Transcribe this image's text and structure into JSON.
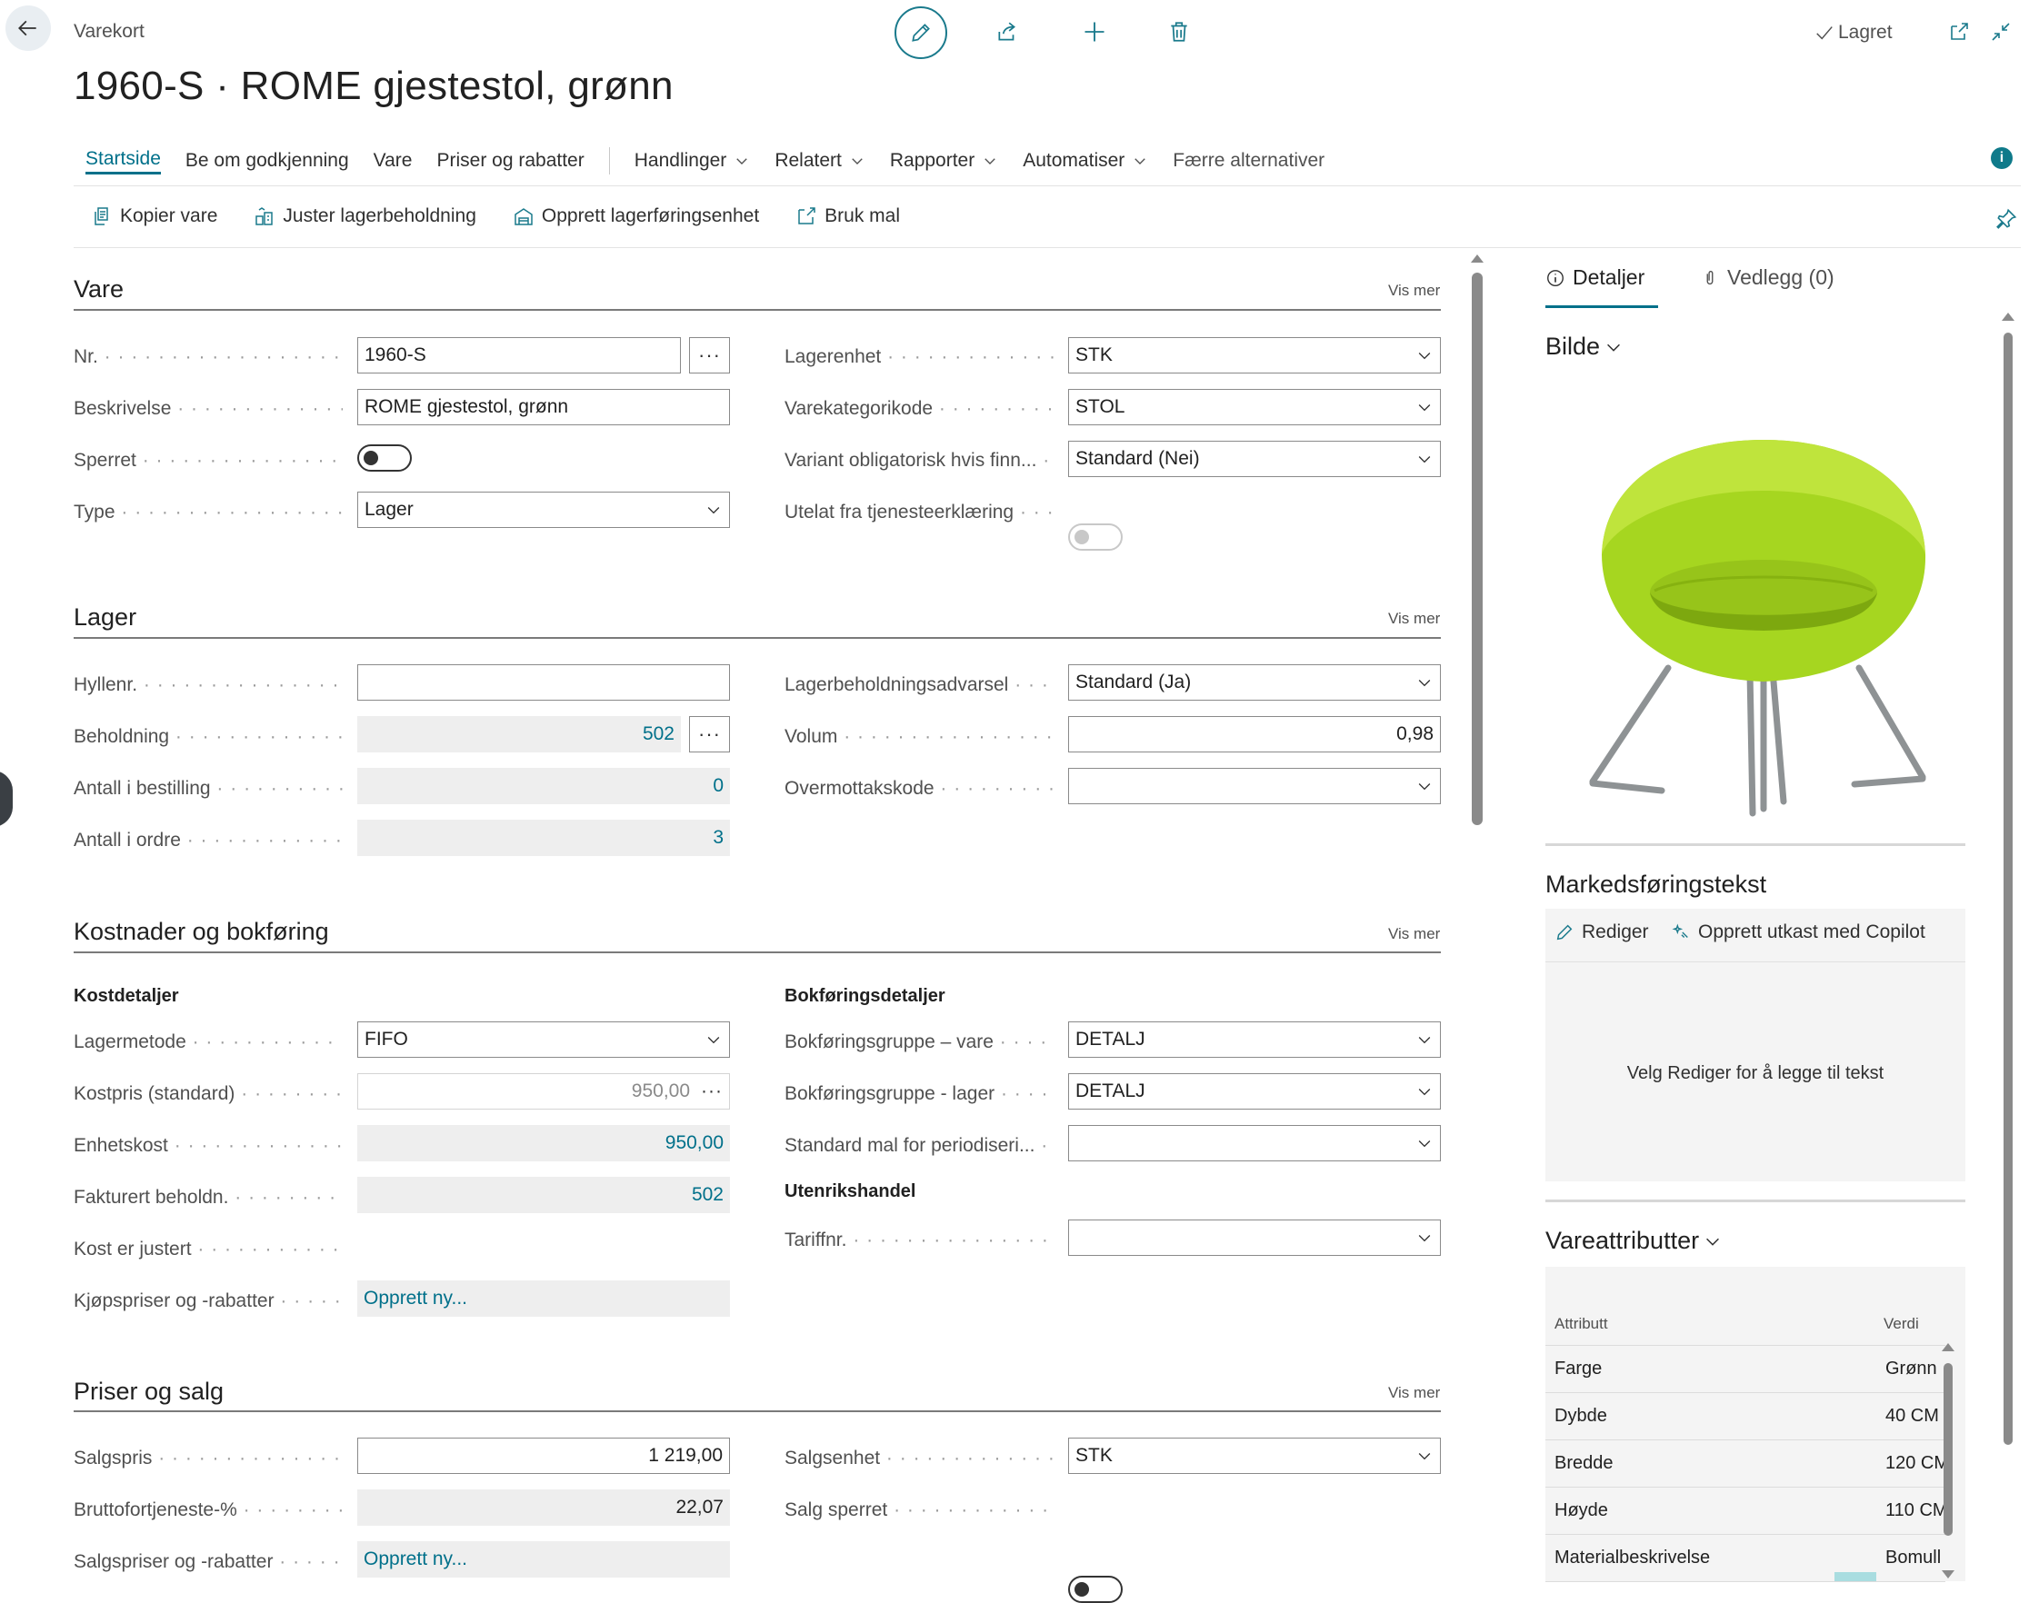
{
  "header": {
    "breadcrumb": "Varekort",
    "title": "1960-S · ROME gjestestol, grønn",
    "saved": "Lagret"
  },
  "menu": {
    "items": [
      "Startside",
      "Be om godkjenning",
      "Vare",
      "Priser og rabatter"
    ],
    "dropdowns": [
      "Handlinger",
      "Relatert",
      "Rapporter",
      "Automatiser"
    ],
    "fewer": "Færre alternativer"
  },
  "promoted": [
    "Kopier vare",
    "Juster lagerbeholdning",
    "Opprett lagerføringsenhet",
    "Bruk mal"
  ],
  "vis_mer": "Vis mer",
  "vare": {
    "title": "Vare",
    "nr_label": "Nr.",
    "nr": "1960-S",
    "beskrivelse_label": "Beskrivelse",
    "beskrivelse": "ROME gjestestol, grønn",
    "sperret_label": "Sperret",
    "type_label": "Type",
    "type": "Lager",
    "lagerenhet_label": "Lagerenhet",
    "lagerenhet": "STK",
    "varekategori_label": "Varekategorikode",
    "varekategori": "STOL",
    "variant_label": "Variant obligatorisk hvis finn...",
    "variant": "Standard (Nei)",
    "utelat_label": "Utelat fra tjenesteerklæring"
  },
  "lager": {
    "title": "Lager",
    "hyllenr_label": "Hyllenr.",
    "hyllenr": "",
    "beholdning_label": "Beholdning",
    "beholdning": "502",
    "antall_bestilling_label": "Antall i bestilling",
    "antall_bestilling": "0",
    "antall_ordre_label": "Antall i ordre",
    "antall_ordre": "3",
    "advarsel_label": "Lagerbeholdningsadvarsel",
    "advarsel": "Standard (Ja)",
    "volum_label": "Volum",
    "volum": "0,98",
    "overmottak_label": "Overmottakskode",
    "overmottak": ""
  },
  "kost": {
    "title": "Kostnader og bokføring",
    "kostdetaljer": "Kostdetaljer",
    "lagermetode_label": "Lagermetode",
    "lagermetode": "FIFO",
    "kostpris_label": "Kostpris (standard)",
    "kostpris": "950,00",
    "enhetskost_label": "Enhetskost",
    "enhetskost": "950,00",
    "fakturert_label": "Fakturert beholdn.",
    "fakturert": "502",
    "kost_justert_label": "Kost er justert",
    "kjopspriser_label": "Kjøpspriser og -rabatter",
    "kjopspriser": "Opprett ny...",
    "bokforingsdetaljer": "Bokføringsdetaljer",
    "bgvare_label": "Bokføringsgruppe – vare",
    "bgvare": "DETALJ",
    "bglager_label": "Bokføringsgruppe - lager",
    "bglager": "DETALJ",
    "periodisering_label": "Standard mal for periodiseri...",
    "periodisering": "",
    "utenrikshandel": "Utenrikshandel",
    "tariff_label": "Tariffnr.",
    "tariff": ""
  },
  "priser": {
    "title": "Priser og salg",
    "salgspris_label": "Salgspris",
    "salgspris": "1 219,00",
    "brutto_label": "Bruttofortjeneste-%",
    "brutto": "22,07",
    "salgspriser_label": "Salgspriser og -rabatter",
    "salgspriser": "Opprett ny...",
    "salgsenhet_label": "Salgsenhet",
    "salgsenhet": "STK",
    "salg_sperret_label": "Salg sperret"
  },
  "factbox": {
    "tab_details": "Detaljer",
    "tab_attachments": "Vedlegg (0)",
    "bilde": "Bilde",
    "markedsforing": "Markedsføringstekst",
    "rediger": "Rediger",
    "copilot": "Opprett utkast med Copilot",
    "empty_text": "Velg Rediger for å legge til tekst",
    "vareattributter": "Vareattributter",
    "attr_col": "Attributt",
    "val_col": "Verdi",
    "attributes": [
      {
        "k": "Farge",
        "v": "Grønn"
      },
      {
        "k": "Dybde",
        "v": "40 CM"
      },
      {
        "k": "Bredde",
        "v": "120 CM"
      },
      {
        "k": "Høyde",
        "v": "110 CM"
      },
      {
        "k": "Materialbeskrivelse",
        "v": "Bomull"
      }
    ]
  },
  "colors": {
    "accent": "#00708a",
    "chair": "#a6d620"
  }
}
